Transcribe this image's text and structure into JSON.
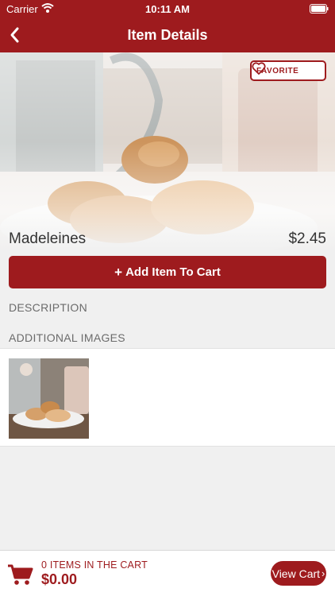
{
  "status_bar": {
    "carrier": "Carrier",
    "time": "10:11 AM"
  },
  "header": {
    "title": "Item Details"
  },
  "item": {
    "favorite_label": "FAVORITE",
    "name": "Madeleines",
    "price": "$2.45",
    "add_to_cart_label": "Add Item To Cart",
    "add_to_cart_icon": "+"
  },
  "sections": {
    "description_label": "DESCRIPTION",
    "additional_images_label": "ADDITIONAL IMAGES"
  },
  "cart": {
    "items_label": "0 ITEMS IN THE CART",
    "total": "$0.00",
    "view_cart_label": "View Cart",
    "view_cart_chevron": "›"
  },
  "colors": {
    "brand": "#9e1b1e",
    "background": "#f0f0f0"
  },
  "icons": [
    "wifi-icon",
    "battery-icon",
    "back-chevron-icon",
    "heart-icon",
    "plus-icon",
    "cart-icon",
    "chevron-right-icon"
  ]
}
